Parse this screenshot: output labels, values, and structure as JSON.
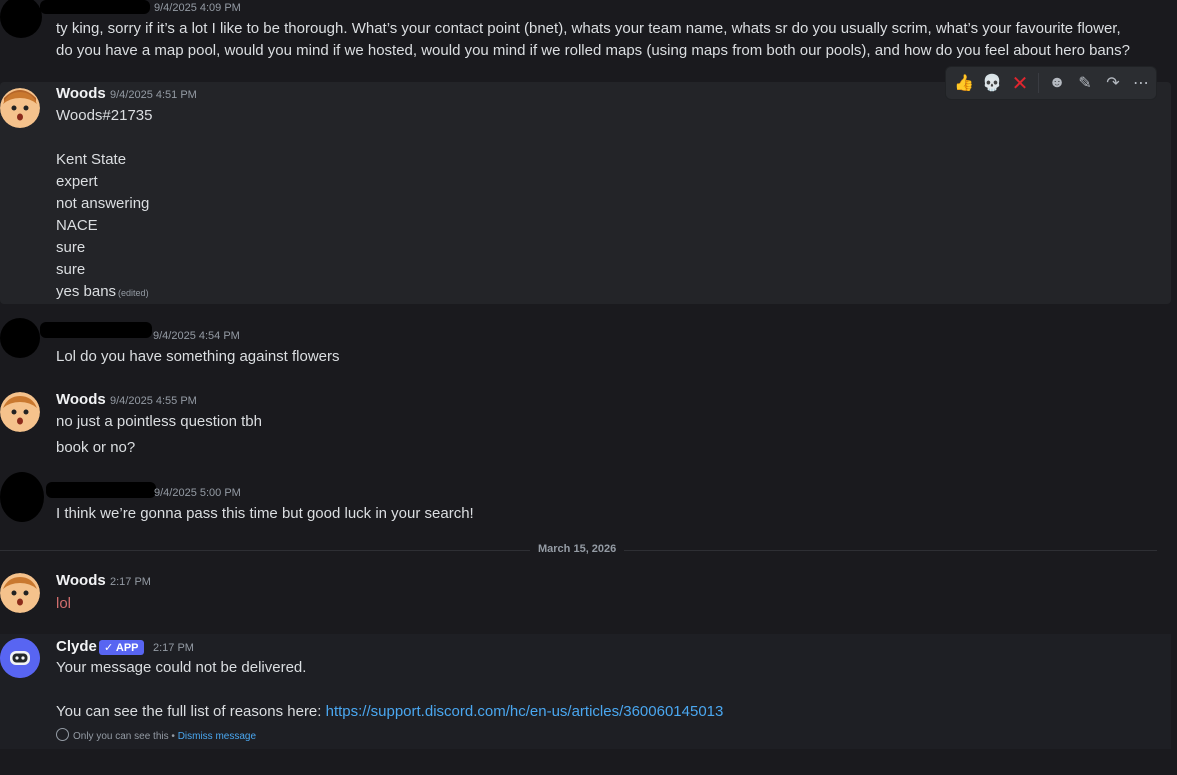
{
  "toolbar": {
    "icons": [
      "thumbs-up",
      "skull",
      "cross-mark",
      "add-reaction",
      "edit",
      "forward",
      "more"
    ]
  },
  "messages": {
    "m1": {
      "timestamp": "9/4/2025 4:09 PM",
      "line1": "ty king, sorry if it’s a lot I like to be thorough. What’s your contact point (bnet), whats your team name, whats sr do you usually scrim, what’s your favourite flower,",
      "line2": "do you have a map pool, would you mind if we hosted, would you mind if we rolled maps (using maps from both our pools), and how do you feel about hero bans?"
    },
    "m2": {
      "author": "Woods",
      "timestamp": "9/4/2025 4:51 PM",
      "lines": [
        "Woods#21735",
        "",
        "Kent State",
        "expert",
        "not answering",
        "NACE",
        "sure",
        "sure",
        "yes bans"
      ],
      "edited": "(edited)"
    },
    "m3": {
      "timestamp": "9/4/2025 4:54 PM",
      "text": "Lol do you have something against flowers"
    },
    "m4": {
      "author": "Woods",
      "timestamp": "9/4/2025 4:55 PM",
      "line1": "no just a pointless question tbh",
      "line2": "book or no?"
    },
    "m5": {
      "timestamp": "9/4/2025 5:00 PM",
      "text": "I think we’re gonna pass this time but good luck in your search!"
    },
    "divider": "March 15, 2026",
    "m6": {
      "author": "Woods",
      "timestamp": "2:17 PM",
      "text": "lol"
    },
    "m7": {
      "author": "Clyde",
      "badge": "APP",
      "timestamp": "2:17 PM",
      "line1": "Your message could not be delivered.",
      "line2_prefix": "You can see the full list of reasons here: ",
      "link": "https://support.discord.com/hc/en-us/articles/360060145013",
      "ephemeral_note": "Only you can see this",
      "separator": "•",
      "dismiss": "Dismiss message"
    }
  },
  "colors": {
    "link": "#4aa7f0",
    "badge": "#5865f2",
    "error_text": "#d06d6d"
  }
}
